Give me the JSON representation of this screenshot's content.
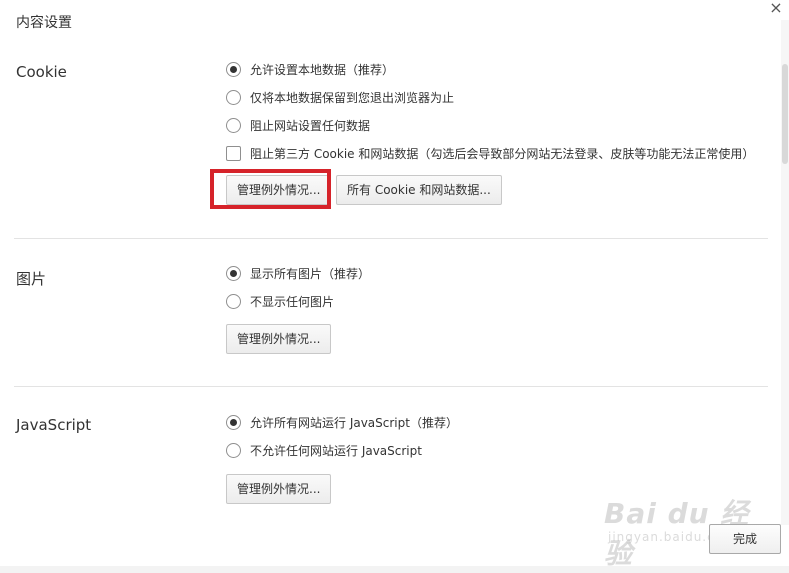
{
  "dialog": {
    "title": "内容设置",
    "close_label": "×",
    "done_label": "完成"
  },
  "cookie": {
    "label": "Cookie",
    "options": [
      {
        "label": "允许设置本地数据（推荐）",
        "checked": true
      },
      {
        "label": "仅将本地数据保留到您退出浏览器为止",
        "checked": false
      },
      {
        "label": "阻止网站设置任何数据",
        "checked": false
      }
    ],
    "block_third_party": {
      "label": "阻止第三方 Cookie 和网站数据（勾选后会导致部分网站无法登录、皮肤等功能无法正常使用）",
      "checked": false
    },
    "manage_button": "管理例外情况...",
    "all_cookies_button": "所有 Cookie 和网站数据..."
  },
  "images": {
    "label": "图片",
    "options": [
      {
        "label": "显示所有图片（推荐）",
        "checked": true
      },
      {
        "label": "不显示任何图片",
        "checked": false
      }
    ],
    "manage_button": "管理例外情况..."
  },
  "javascript": {
    "label": "JavaScript",
    "options": [
      {
        "label": "允许所有网站运行 JavaScript（推荐）",
        "checked": true
      },
      {
        "label": "不允许任何网站运行 JavaScript",
        "checked": false
      }
    ],
    "manage_button": "管理例外情况..."
  },
  "watermark": {
    "logo_text": "Bai du 经验",
    "url_text": "jingyan.baidu.com"
  },
  "colors": {
    "highlight": "#d6232a",
    "divider": "#e3e3e3"
  }
}
